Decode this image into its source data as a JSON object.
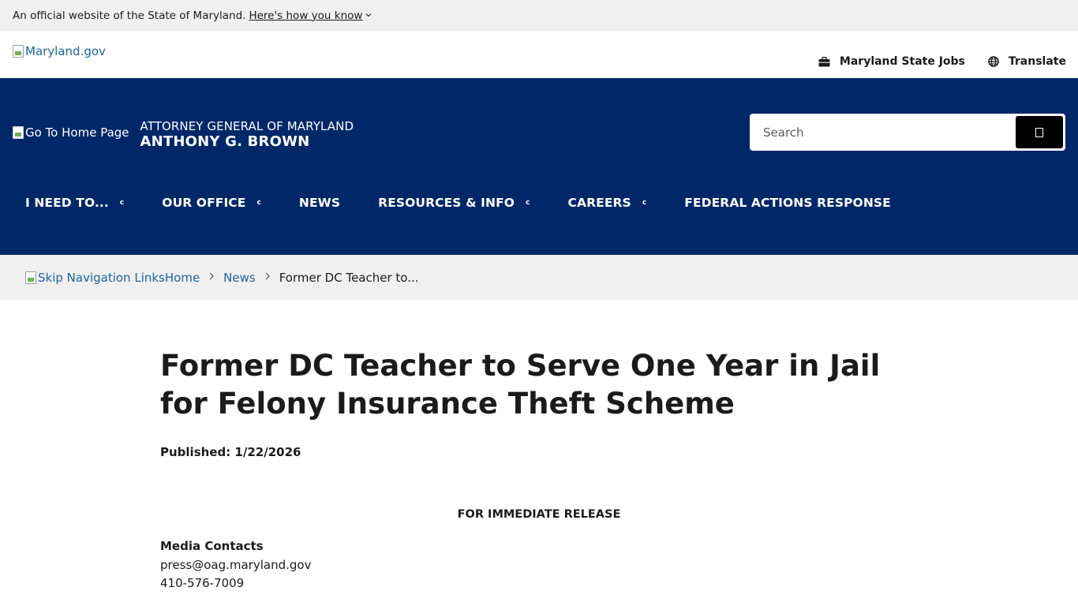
{
  "gov_banner": {
    "text": "An official website of the State of Maryland.",
    "link": "Here's how you know",
    "chevron_icon": "chevron-down-icon"
  },
  "utility": {
    "logo_alt": "Maryland.gov",
    "jobs_label": "Maryland State Jobs",
    "jobs_icon": "briefcase-icon",
    "translate_label": "Translate",
    "translate_icon": "globe-icon"
  },
  "header": {
    "home_img_alt": "Go To Home Page",
    "agency": "ATTORNEY GENERAL OF MARYLAND",
    "name": "ANTHONY G. BROWN",
    "search_placeholder": "Search",
    "colors": {
      "header_bg": "#002868",
      "link": "#1a66a0"
    }
  },
  "nav": {
    "items": [
      {
        "label": "I NEED TO...",
        "caret": "c"
      },
      {
        "label": "OUR OFFICE",
        "caret": "c"
      },
      {
        "label": "NEWS",
        "caret": ""
      },
      {
        "label": "RESOURCES & INFO",
        "caret": "c"
      },
      {
        "label": "CAREERS",
        "caret": "c"
      },
      {
        "label": "FEDERAL ACTIONS RESPONSE",
        "caret": ""
      }
    ]
  },
  "breadcrumb": {
    "skip_alt": "Skip Navigation Links",
    "home": "Home",
    "news": "News",
    "current": "Former DC Teacher to..."
  },
  "article": {
    "title": "Former DC Teacher to Serve One Year in Jail for Felony Insurance Theft Scheme",
    "published": "Published: 1/22/2026",
    "release": "FOR IMMEDIATE RELEASE",
    "media_label": "Media Contacts",
    "email": "press@oag.maryland.gov",
    "phone": "410-576-7009"
  }
}
